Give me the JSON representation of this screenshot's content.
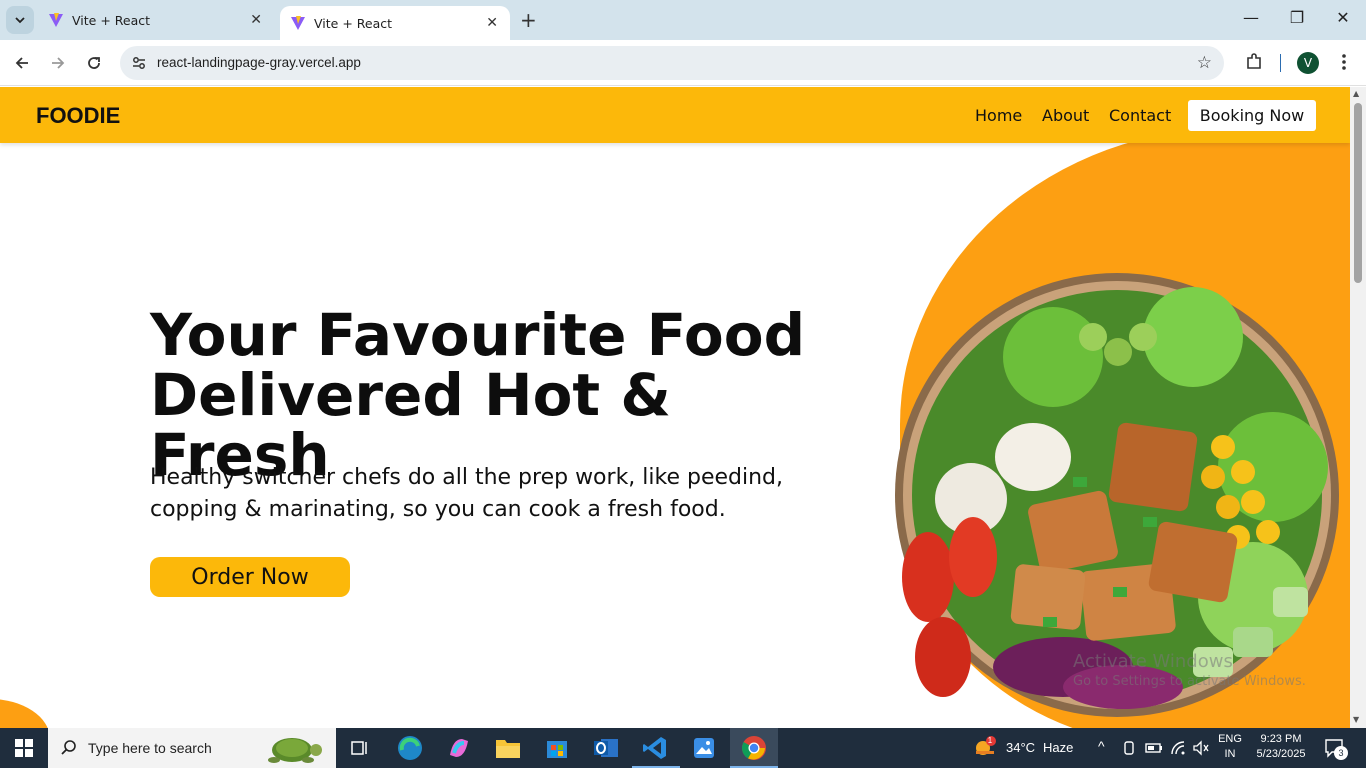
{
  "browser": {
    "tabs": [
      {
        "title": "Vite + React",
        "active": false
      },
      {
        "title": "Vite + React",
        "active": true
      }
    ],
    "url": "react-landingpage-gray.vercel.app",
    "profile_initial": "V"
  },
  "site": {
    "logo": "FOODIE",
    "nav": {
      "home": "Home",
      "about": "About",
      "contact": "Contact",
      "booking": "Booking Now"
    },
    "hero": {
      "title_line1": "Your Favourite Food",
      "title_line2": "Delivered Hot & Fresh",
      "subtitle": "Healthy switcher chefs do all the prep work, like peedind, copping & marinating, so you can cook a fresh food.",
      "cta": "Order Now"
    },
    "colors": {
      "accent": "#fcb80a",
      "blob": "#fd9f12"
    }
  },
  "watermark": {
    "line1": "Activate Windows",
    "line2": "Go to Settings to activate Windows."
  },
  "taskbar": {
    "search_placeholder": "Type here to search",
    "weather_temp": "34°C",
    "weather_text": "Haze",
    "lang_top": "ENG",
    "lang_bottom": "IN",
    "time": "9:23 PM",
    "date": "5/23/2025",
    "notifications": "3"
  }
}
